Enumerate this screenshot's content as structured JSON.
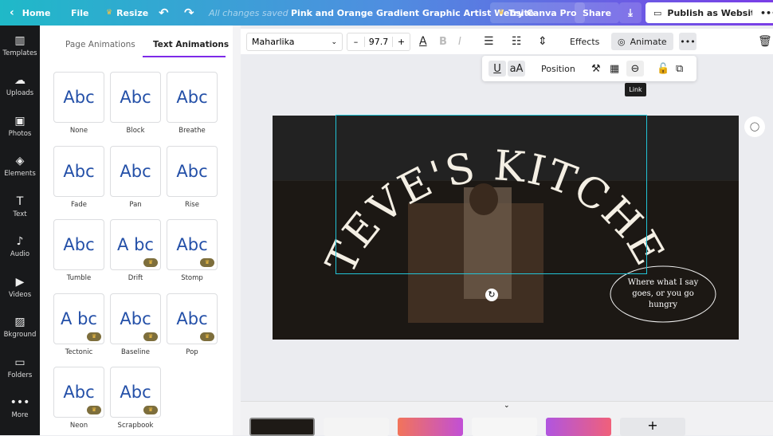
{
  "topbar": {
    "home": "Home",
    "file": "File",
    "resize": "Resize",
    "status": "All changes saved",
    "title": "Pink and Orange Gradient Graphic Artist Website",
    "try_pro": "Try Canva Pro",
    "share": "Share",
    "publish": "Publish as Website"
  },
  "sidebar": {
    "items": [
      {
        "label": "Templates",
        "icon": "▥"
      },
      {
        "label": "Uploads",
        "icon": "☁"
      },
      {
        "label": "Photos",
        "icon": "▣"
      },
      {
        "label": "Elements",
        "icon": "◈"
      },
      {
        "label": "Text",
        "icon": "T"
      },
      {
        "label": "Audio",
        "icon": "♪"
      },
      {
        "label": "Videos",
        "icon": "▶"
      },
      {
        "label": "Bkground",
        "icon": "▨"
      },
      {
        "label": "Folders",
        "icon": "▭"
      },
      {
        "label": "More",
        "icon": "•••"
      }
    ]
  },
  "panel": {
    "tabs": [
      "Page Animations",
      "Text Animations"
    ],
    "active_tab": "Text Animations",
    "animations": [
      {
        "sample": "Abc",
        "label": "None",
        "pro": false
      },
      {
        "sample": "Abc",
        "label": "Block",
        "pro": false
      },
      {
        "sample": "Abc",
        "label": "Breathe",
        "pro": false
      },
      {
        "sample": "Abc",
        "label": "Fade",
        "pro": false
      },
      {
        "sample": "Abc",
        "label": "Pan",
        "pro": false
      },
      {
        "sample": "Abc",
        "label": "Rise",
        "pro": false
      },
      {
        "sample": "Abc",
        "label": "Tumble",
        "pro": false
      },
      {
        "sample": "A bc",
        "label": "Drift",
        "pro": true
      },
      {
        "sample": "Abc",
        "label": "Stomp",
        "pro": true
      },
      {
        "sample": "A bc",
        "label": "Tectonic",
        "pro": true
      },
      {
        "sample": "Abc",
        "label": "Baseline",
        "pro": true
      },
      {
        "sample": "Abc",
        "label": "Pop",
        "pro": true
      },
      {
        "sample": "Abc",
        "label": "Neon",
        "pro": true
      },
      {
        "sample": "Abc",
        "label": "Scrapbook",
        "pro": true
      }
    ]
  },
  "toolbar": {
    "font": "Maharlika",
    "font_size": "97.7",
    "minus": "–",
    "plus": "+",
    "effects": "Effects",
    "animate": "Animate"
  },
  "floatbar": {
    "position": "Position",
    "underline": "U",
    "case": "aA",
    "tooltip": "Link"
  },
  "design": {
    "headline": "STEVE'S KITCHEN",
    "tagline": "Where what I say goes, or you go hungry"
  },
  "colors": {
    "accent": "#7d2ae8",
    "sidebar": "#18191b"
  }
}
